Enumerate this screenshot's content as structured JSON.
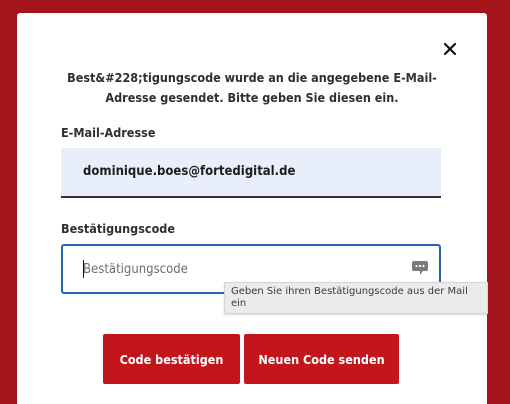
{
  "modal": {
    "close_icon": "close-icon",
    "message": "Best&#228;tigungscode wurde an die angegebene E-Mail-Adresse gesendet. Bitte geben Sie diesen ein.",
    "email": {
      "label": "E-Mail-Adresse",
      "value": "dominique.boes@fortedigital.de"
    },
    "code": {
      "label": "Bestätigungscode",
      "placeholder": "Bestätigungscode",
      "icon": "comment-icon",
      "tooltip": "Geben Sie ihren Bestätigungscode aus der Mail ein"
    },
    "buttons": {
      "confirm": "Code bestätigen",
      "resend": "Neuen Code senden"
    }
  },
  "colors": {
    "background": "#a3151b",
    "primary_button": "#c3161c",
    "focus_border": "#2a62b8",
    "email_field_bg": "#e8effa"
  }
}
